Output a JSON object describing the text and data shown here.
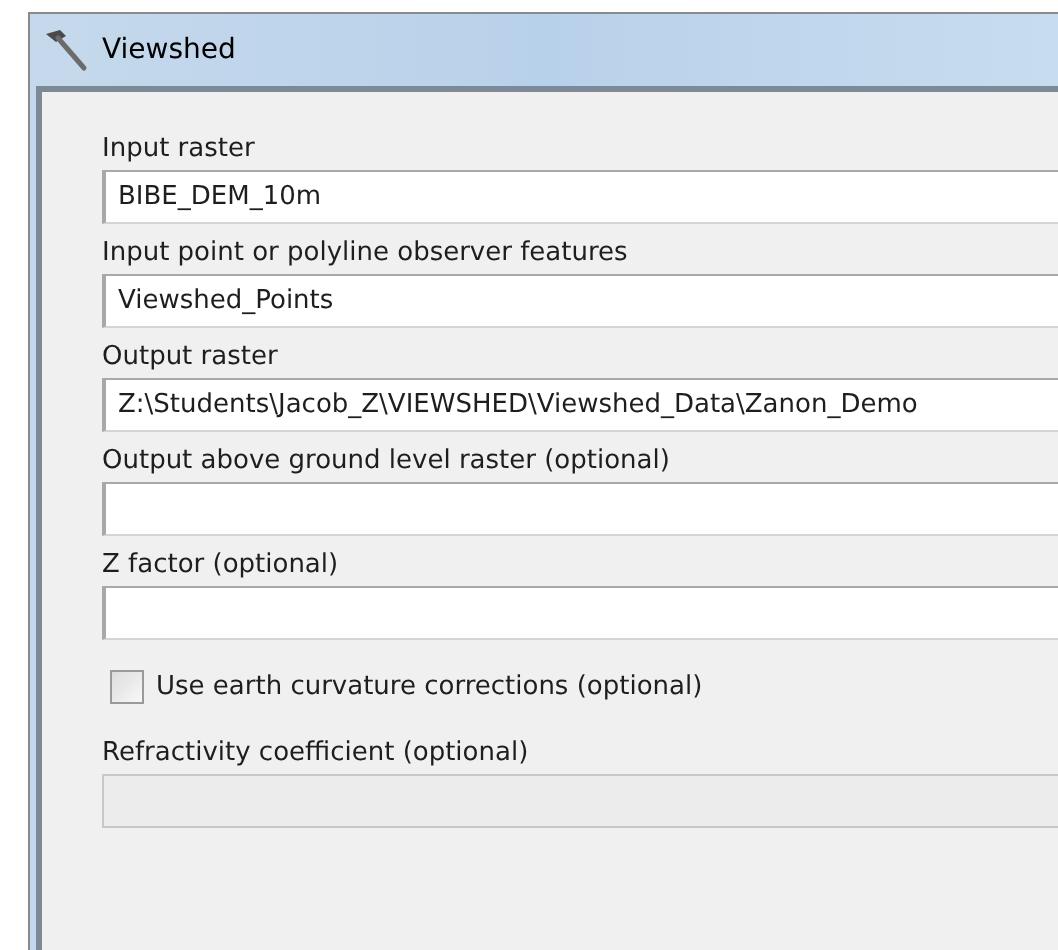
{
  "window": {
    "title": "Viewshed"
  },
  "parameters": [
    {
      "kind": "field",
      "label": "Input raster",
      "value": "BIBE_DEM_10m",
      "disabled": false
    },
    {
      "kind": "field",
      "label": "Input point or polyline observer features",
      "value": "Viewshed_Points",
      "disabled": false
    },
    {
      "kind": "field",
      "label": "Output raster",
      "value": "Z:\\Students\\Jacob_Z\\VIEWSHED\\Viewshed_Data\\Zanon_Demo",
      "disabled": false
    },
    {
      "kind": "field",
      "label": "Output above ground level raster (optional)",
      "disabled": false
    },
    {
      "kind": "field",
      "label": "Z factor (optional)",
      "disabled": false
    },
    {
      "kind": "checkbox",
      "label": "Use earth curvature corrections (optional)",
      "checked": false
    },
    {
      "kind": "field",
      "label": "Refractivity coefficient (optional)",
      "disabled": true
    }
  ]
}
